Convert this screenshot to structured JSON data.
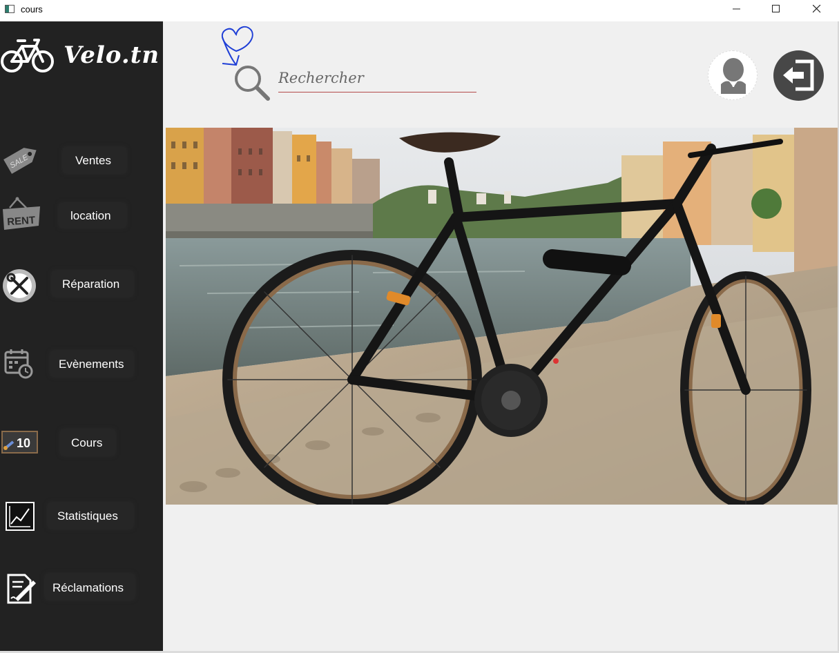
{
  "window": {
    "title": "cours",
    "minimize": "—",
    "maximize": "☐",
    "close": "✕"
  },
  "brand": {
    "name": "Velo.tn",
    "logo_icon": "bicycle-icon"
  },
  "sidebar": {
    "items": [
      {
        "label": "Ventes",
        "icon": "sale-tag-icon"
      },
      {
        "label": "location",
        "icon": "rent-sign-icon"
      },
      {
        "label": "Réparation",
        "icon": "wrench-screwdriver-icon"
      },
      {
        "label": "Evènements",
        "icon": "calendar-clock-icon"
      },
      {
        "label": "Cours",
        "icon": "chalkboard-icon"
      },
      {
        "label": "Statistiques",
        "icon": "line-chart-icon"
      },
      {
        "label": "Réclamations",
        "icon": "document-pen-icon"
      }
    ]
  },
  "search": {
    "placeholder": "Rechercher",
    "value": ""
  },
  "header": {
    "avatar_icon": "user-avatar-icon",
    "logout_icon": "logout-icon"
  },
  "colors": {
    "sidebar": "#222222",
    "content": "#f0f0f0",
    "search_underline": "#b34a4a",
    "logout_bg": "#474747",
    "annotation": "#1f3fd6"
  }
}
